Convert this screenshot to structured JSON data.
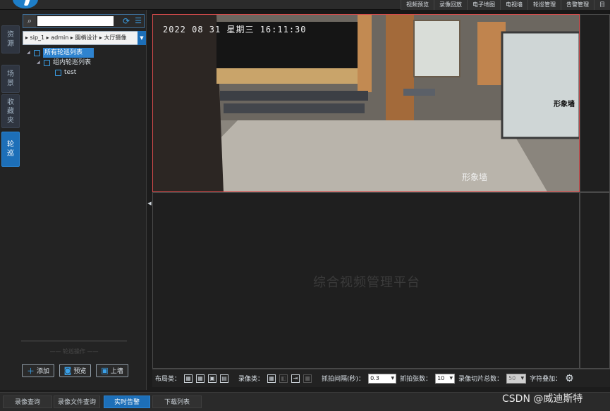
{
  "top_nav": {
    "items": [
      "视频预览",
      "录像回放",
      "电子地图",
      "电视墙",
      "轮巡管理",
      "告警管理",
      "日"
    ]
  },
  "side_tabs": [
    {
      "label": "资源"
    },
    {
      "label": "场景"
    },
    {
      "label": "收藏夹"
    },
    {
      "label": "轮巡"
    }
  ],
  "search": {
    "placeholder": "",
    "value": ""
  },
  "path": {
    "text": "▸ sip_1 ▸ admin ▸ 園梢设计 ▸ 大厅摄像"
  },
  "tree": {
    "root": "所有轮巡列表",
    "group": "组内轮巡列表",
    "leaf": "test"
  },
  "left_divider_caption": "—— 轮巡操作 ——",
  "left_buttons": {
    "add": "添加",
    "preview": "预览",
    "wall": "上墙"
  },
  "video": {
    "osd_time": "2022 08 31 星期三 16:11:30",
    "osd_name": "形象墙",
    "osd_side": "形象墙",
    "watermark": "综合视频管理平台"
  },
  "toolbar": {
    "layout_label": "布局类：",
    "record_label": "录像类：",
    "interval_label": "抓拍间隔(秒)：",
    "interval_value": "0.3",
    "count_label": "抓拍张数：",
    "count_value": "10",
    "slice_label": "录像切片总数：",
    "slice_value": "50",
    "overlay_label": "字符叠加："
  },
  "bottom_tabs": [
    "录像查询",
    "录像文件查询",
    "实时告警",
    "下载列表"
  ],
  "watermark_footer": "CSDN @威迪斯特",
  "colors": {
    "accent": "#1d6fb8",
    "selected_pane_border": "#d74b4b",
    "background": "#1c1c1c"
  }
}
